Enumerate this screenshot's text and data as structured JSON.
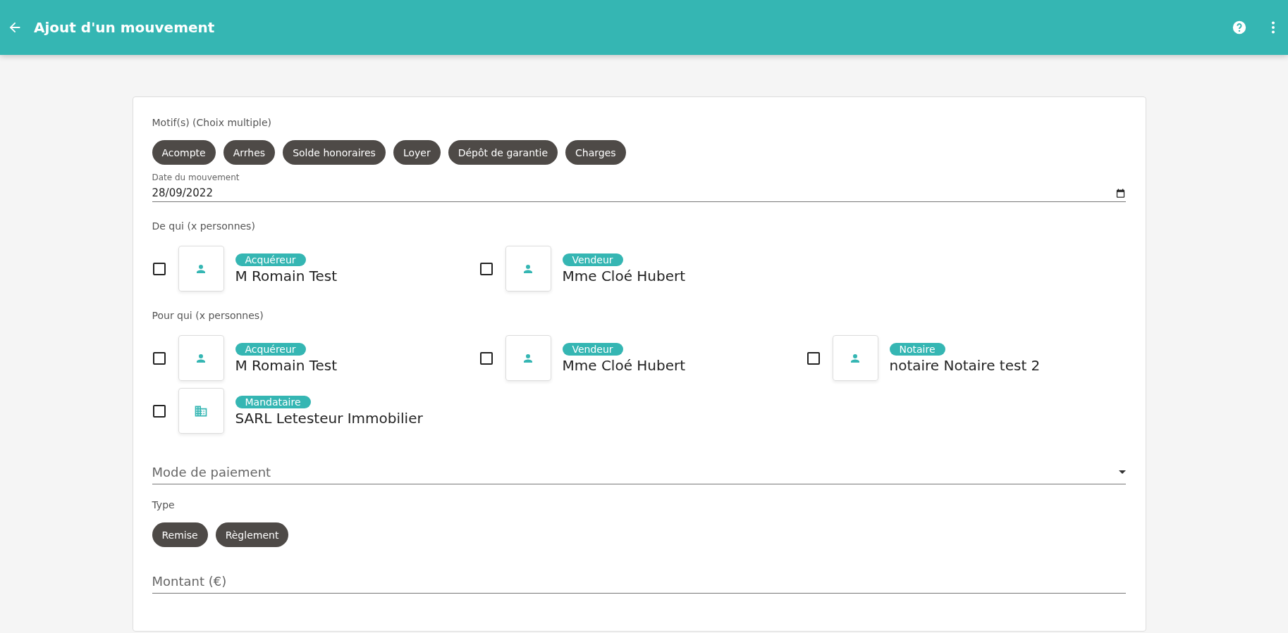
{
  "header": {
    "title": "Ajout d'un mouvement"
  },
  "motifs": {
    "label": "Motif(s) (Choix multiple)",
    "chips": [
      {
        "label": "Acompte",
        "selected": false
      },
      {
        "label": "Arrhes",
        "selected": false
      },
      {
        "label": "Solde honoraires",
        "selected": false
      },
      {
        "label": "Loyer",
        "selected": false
      },
      {
        "label": "Dépôt de garantie",
        "selected": false
      },
      {
        "label": "Charges",
        "selected": false
      }
    ]
  },
  "date": {
    "label": "Date du mouvement",
    "value": "28/09/2022"
  },
  "de_qui": {
    "label": "De qui (x personnes)",
    "people": [
      {
        "role": "Acquéreur",
        "name": "M Romain Test",
        "kind": "person",
        "checked": false
      },
      {
        "role": "Vendeur",
        "name": "Mme Cloé Hubert",
        "kind": "person",
        "checked": false
      }
    ]
  },
  "pour_qui": {
    "label": "Pour qui (x personnes)",
    "people": [
      {
        "role": "Acquéreur",
        "name": "M Romain Test",
        "kind": "person",
        "checked": false
      },
      {
        "role": "Vendeur",
        "name": "Mme Cloé Hubert",
        "kind": "person",
        "checked": false
      },
      {
        "role": "Notaire",
        "name": "notaire Notaire test 2",
        "kind": "person",
        "checked": false
      },
      {
        "role": "Mandataire",
        "name": "SARL Letesteur Immobilier",
        "kind": "company",
        "checked": false
      }
    ]
  },
  "mode_paiement": {
    "placeholder": "Mode de paiement"
  },
  "type": {
    "label": "Type",
    "chips": [
      {
        "label": "Remise",
        "selected": false
      },
      {
        "label": "Règlement",
        "selected": false
      }
    ]
  },
  "montant": {
    "placeholder": "Montant (€)"
  }
}
